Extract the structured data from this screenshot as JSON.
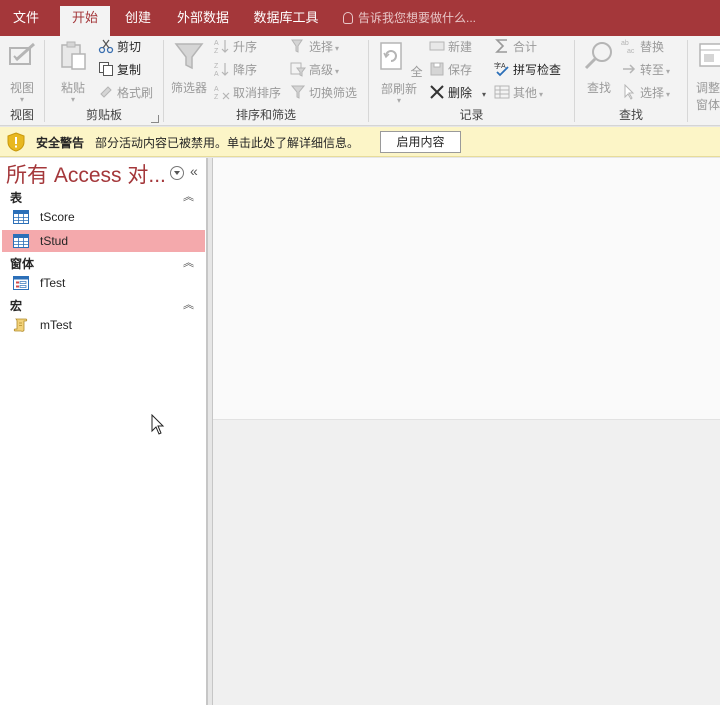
{
  "tabs": [
    {
      "label": "文件",
      "active": false
    },
    {
      "label": "开始",
      "active": true
    },
    {
      "label": "创建",
      "active": false
    },
    {
      "label": "外部数据",
      "active": false
    },
    {
      "label": "数据库工具",
      "active": false
    }
  ],
  "tell_me": "告诉我您想要做什么...",
  "ribbon": {
    "view": {
      "label": "视图",
      "group": "视图"
    },
    "clipboard": {
      "paste": "粘贴",
      "cut": "剪切",
      "copy": "复制",
      "format_painter": "格式刷",
      "group": "剪贴板"
    },
    "sort_filter": {
      "filter": "筛选器",
      "ascending": "升序",
      "descending": "降序",
      "clear_sort": "取消排序",
      "selection": "选择",
      "advanced": "高级",
      "toggle_filter": "切换筛选",
      "group": "排序和筛选"
    },
    "records": {
      "refresh_all": "全部刷新",
      "new": "新建",
      "save": "保存",
      "delete": "删除",
      "totals": "合计",
      "spelling": "拼写检查",
      "more": "其他",
      "group": "记录"
    },
    "find": {
      "find": "查找",
      "replace": "替换",
      "goto": "转至",
      "select": "选择",
      "group": "查找"
    },
    "window": {
      "resize": "调整",
      "resize2": "窗体大"
    }
  },
  "security_bar": {
    "title": "安全警告",
    "message": "部分活动内容已被禁用。单击此处了解详细信息。",
    "button": "启用内容"
  },
  "nav": {
    "title": "所有 Access 对...",
    "categories": [
      {
        "label": "表",
        "items": [
          {
            "label": "tScore",
            "type": "table",
            "selected": false
          },
          {
            "label": "tStud",
            "type": "table",
            "selected": true
          }
        ]
      },
      {
        "label": "窗体",
        "items": [
          {
            "label": "fTest",
            "type": "form",
            "selected": false
          }
        ]
      },
      {
        "label": "宏",
        "items": [
          {
            "label": "mTest",
            "type": "macro",
            "selected": false
          }
        ]
      }
    ]
  },
  "colors": {
    "accent": "#a4373a",
    "selected": "#f4a9ac",
    "warning_bg": "#fcf5c7"
  }
}
